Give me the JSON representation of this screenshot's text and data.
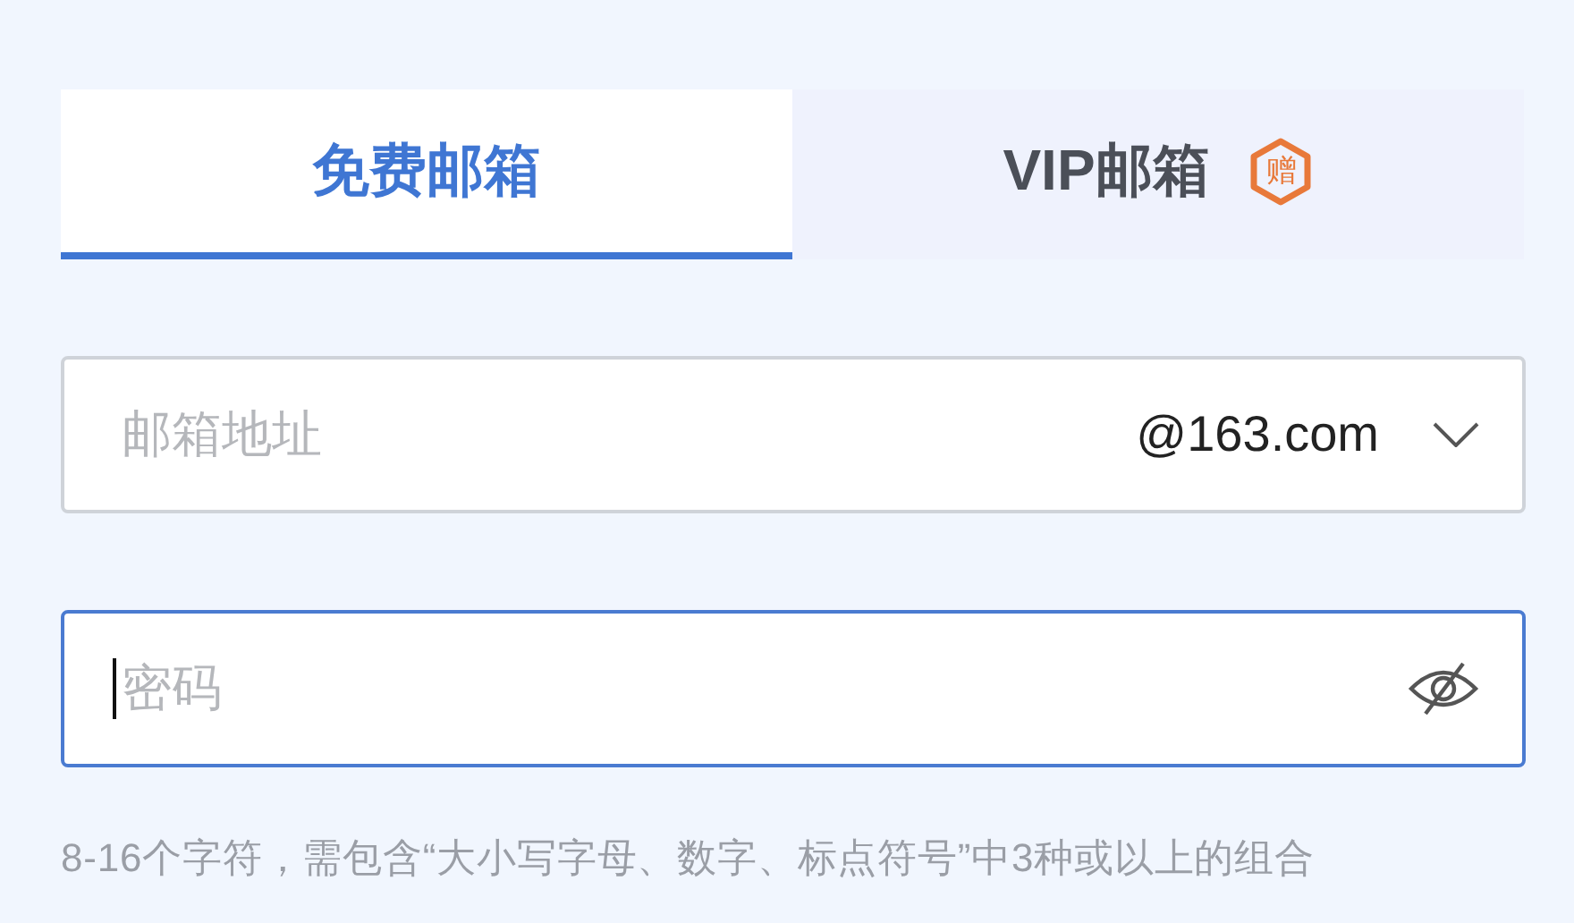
{
  "tabs": [
    {
      "label": "免费邮箱",
      "selected": true
    },
    {
      "label": "VIP邮箱",
      "selected": false,
      "badge": "赠"
    }
  ],
  "fields": [
    {
      "kind": "email",
      "placeholder": "邮箱地址",
      "domain": "@163.com",
      "focused": false
    },
    {
      "kind": "password",
      "placeholder": "密码",
      "focused": true
    }
  ],
  "hint": "8-16个字符，需包含“大小写字母、数字、标点符号”中3种或以上的组合"
}
